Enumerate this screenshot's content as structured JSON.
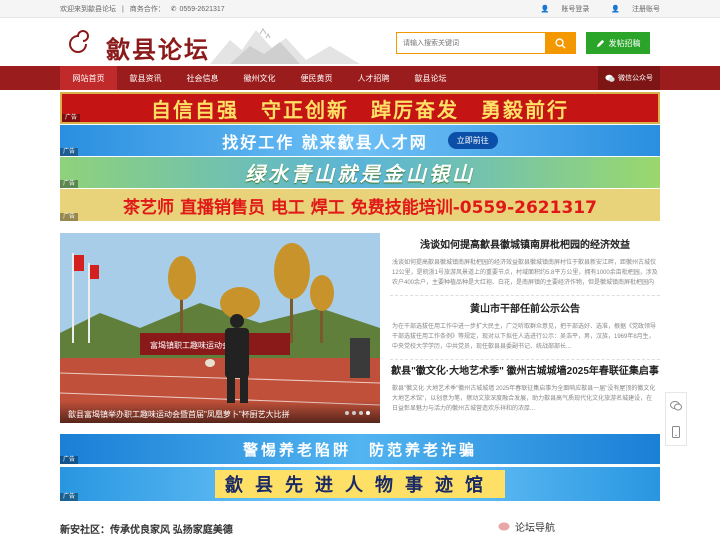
{
  "topbar": {
    "welcome": "欢迎来到歙县论坛",
    "business": "商务合作：",
    "phone": "0559-2621317",
    "login": "账号登录",
    "register": "注册账号"
  },
  "header": {
    "logo_text": "歙县论坛",
    "search_placeholder": "请输入搜索关键词",
    "post_button": "发帖招稿"
  },
  "nav": {
    "items": [
      "网站首页",
      "歙县资讯",
      "社会信息",
      "徽州文化",
      "便民黄页",
      "人才招聘",
      "歙县论坛"
    ],
    "active_index": 0,
    "wechat": "微信公众号"
  },
  "banners": {
    "ad_label": "广告",
    "b1": "自信自强　守正创新　踔厉奋发　勇毅前行",
    "b2": "找好工作 就来歙县人才网",
    "b2_button": "立即前往",
    "b3": "绿水青山就是金山银山",
    "b4": "茶艺师 直播销售员 电工 焊工 免费技能培训-0559-2621317",
    "b5": "警惕养老陷阱　防范养老诈骗",
    "b6": "歙县先进人物事迹馆"
  },
  "slide": {
    "caption": "歙县富堨镇举办职工趣味运动会暨首届\"凤凰萝卜\"杯厨艺大比拼",
    "banner_text": "富堨镇职工趣味运动会",
    "dots": 4,
    "active_dot": 3
  },
  "news": [
    {
      "title": "浅谈如何提高歙县徽城镇南屏枇杷园的经济效益",
      "summary": "浅谈如何提高歙县徽城镇南屏枇杷园的经济效益歙县徽城镇南屏村位于歙县新安江畔，距徽州古城仅12公里，是皖浙1号旅游风景道上的重要节点，村域面积约5.8平方公里，拥有1000余亩枇杷园，涉及农户400余户，主要种植品种是大红袍、白花，是南屏镇的主要经济作物，但是徽城镇南屏枇杷园内最..."
    },
    {
      "title": "黄山市干部任前公示公告",
      "summary": "为在干部选拔任用工作中进一步扩大民主，广泛听取群众意见，把干部选好、选准，根据《党政领导干部选拔任用工作条例》等规定，现对以下拟任人选进行公示：吴浩平，男，汉族，1969年8月生，中央党校大学学历，中共党员，现任歙县县委副书记、统战部部长..."
    },
    {
      "title": "歙县\"徽文化·大地艺术季\" 徽州古城城墙2025年春联征集启事",
      "summary": "歙县\"徽文化·大地艺术季\"徽州古城城墙 2025年春联征集启事为全面响应歙县一届\"没有屋顶的徽文化大地艺术馆\"，以创意为笔，擦动文旅深度融合发展，助力歙县高气质现代化文化旅游名城建设，在日益彰显魅力与活力的徽州古城营造欢乐祥和的浓厚..."
    }
  ],
  "sections": {
    "left_title": "新安社区：传承优良家风 弘扬家庭美德",
    "forum_nav": "论坛导航"
  },
  "colors": {
    "nav_red": "#9b1c1c",
    "accent_orange": "#f39800",
    "post_green": "#2aa52a"
  }
}
